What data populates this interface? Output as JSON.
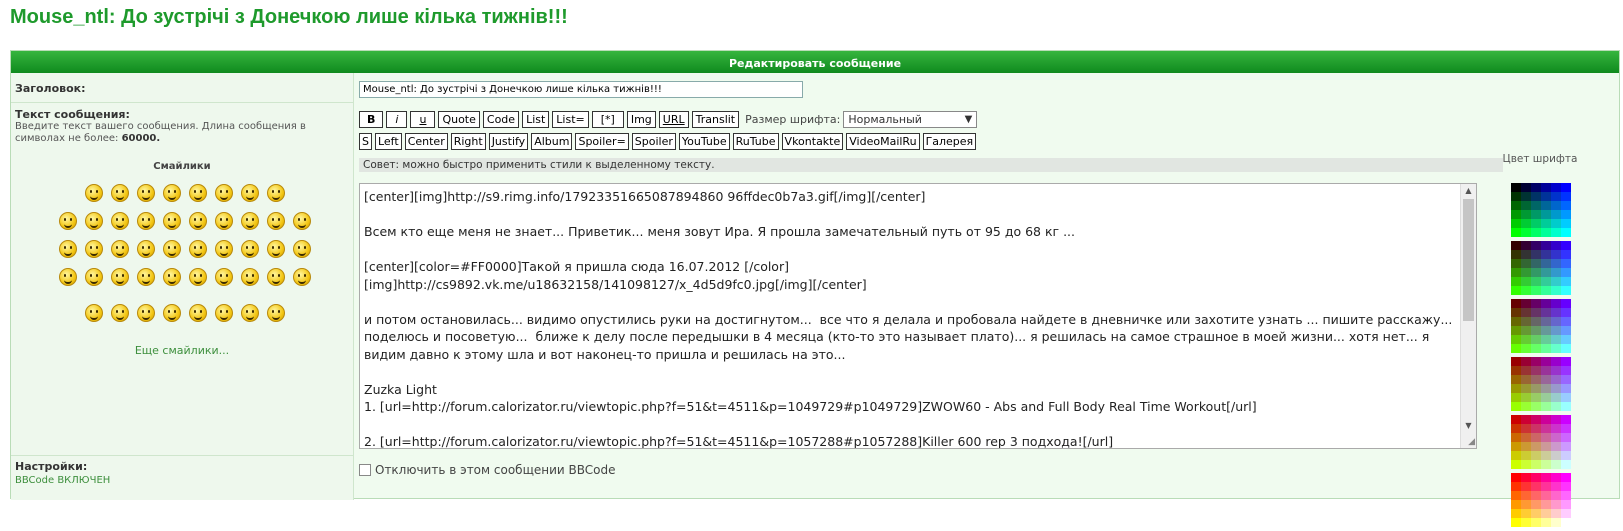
{
  "page_title": "Mouse_ntl: До зустрічі з Донечкою лише кілька тижнів!!!",
  "form_header": "Редактировать сообщение",
  "subject": {
    "label": "Заголовок:",
    "value": "Mouse_ntl: До зустрічі з Донечкою лише кілька тижнів!!!"
  },
  "message": {
    "label": "Текст сообщения:",
    "hint_prefix": "Введите текст вашего сообщения. Длина сообщения в символах не более:",
    "hint_limit": "60000.",
    "smilies_title": "Смайлики",
    "more_smilies": "Еще смайлики...",
    "text": "[center][img]http://s9.rimg.info/17923351665087894860 96ffdec0b7a3.gif[/img][/center]\n\nВсем кто еще меня не знает... Приветик... меня зовут Ира. Я прошла замечательный путь от 95 до 68 кг ...\n\n[center][color=#FF0000]Такой я пришла сюда 16.07.2012 [/color]\n[img]http://cs9892.vk.me/u18632158/141098127/x_4d5d9fc0.jpg[/img][/center]\n\nи потом остановилась... видимо опустились руки на достигнутом...  все что я делала и пробовала найдете в дневничке или захотите узнать ... пишите расскажу... поделюсь и посоветую...  ближе к делу после передышки в 4 месяца (кто-то это называет плато)... я решилась на самое страшное в моей жизни... хотя нет... я видим давно к этому шла и вот наконец-то пришла и решилась на это...\n\nZuzka Light\n1. [url=http://forum.calorizator.ru/viewtopic.php?f=51&t=4511&p=1049729#p1049729]ZWOW60 - Abs and Full Body Real Time Workout[/url]\n\n2. [url=http://forum.calorizator.ru/viewtopic.php?f=51&t=4511&p=1057288#p1057288]Killer 600 rep 3 подхода![/url]"
  },
  "toolbar1": [
    "B",
    "i",
    "u",
    "Quote",
    "Code",
    "List",
    "List=",
    "[*]",
    "Img",
    "URL",
    "Translit"
  ],
  "font_size": {
    "label": "Размер шрифта:",
    "selected": "Нормальный"
  },
  "toolbar2": [
    "S",
    "Left",
    "Center",
    "Right",
    "Justify",
    "Album",
    "Spoiler=",
    "Spoiler",
    "YouTube",
    "RuTube",
    "Vkontakte",
    "VideoMailRu",
    "Галерея"
  ],
  "tip": "Совет: можно быстро применить стили к выделенному тексту.",
  "color_title": "Цвет шрифта",
  "palette": [
    [
      "#000000",
      "#000033",
      "#000066",
      "#000099",
      "#0000cc",
      "#0000ff",
      "#003300",
      "#003333",
      "#003366",
      "#003399",
      "#0033cc",
      "#0033ff",
      "#006600",
      "#006633",
      "#006666",
      "#006699",
      "#0066cc",
      "#0066ff",
      "#009900",
      "#009933",
      "#009966",
      "#009999",
      "#0099cc",
      "#0099ff",
      "#00cc00",
      "#00cc33",
      "#00cc66",
      "#00cc99",
      "#00cccc",
      "#00ccff",
      "#00ff00",
      "#00ff33",
      "#00ff66",
      "#00ff99",
      "#00ffcc",
      "#00ffff"
    ],
    [
      "#330000",
      "#330033",
      "#330066",
      "#330099",
      "#3300cc",
      "#3300ff",
      "#333300",
      "#333333",
      "#333366",
      "#333399",
      "#3333cc",
      "#3333ff",
      "#336600",
      "#336633",
      "#336666",
      "#336699",
      "#3366cc",
      "#3366ff",
      "#339900",
      "#339933",
      "#339966",
      "#339999",
      "#3399cc",
      "#3399ff",
      "#33cc00",
      "#33cc33",
      "#33cc66",
      "#33cc99",
      "#33cccc",
      "#33ccff",
      "#33ff00",
      "#33ff33",
      "#33ff66",
      "#33ff99",
      "#33ffcc",
      "#33ffff"
    ],
    [
      "#660000",
      "#660033",
      "#660066",
      "#660099",
      "#6600cc",
      "#6600ff",
      "#663300",
      "#663333",
      "#663366",
      "#663399",
      "#6633cc",
      "#6633ff",
      "#666600",
      "#666633",
      "#666666",
      "#666699",
      "#6666cc",
      "#6666ff",
      "#669900",
      "#669933",
      "#669966",
      "#669999",
      "#6699cc",
      "#6699ff",
      "#66cc00",
      "#66cc33",
      "#66cc66",
      "#66cc99",
      "#66cccc",
      "#66ccff",
      "#66ff00",
      "#66ff33",
      "#66ff66",
      "#66ff99",
      "#66ffcc",
      "#66ffff"
    ],
    [
      "#990000",
      "#990033",
      "#990066",
      "#990099",
      "#9900cc",
      "#9900ff",
      "#993300",
      "#993333",
      "#993366",
      "#993399",
      "#9933cc",
      "#9933ff",
      "#996600",
      "#996633",
      "#996666",
      "#996699",
      "#9966cc",
      "#9966ff",
      "#999900",
      "#999933",
      "#999966",
      "#999999",
      "#9999cc",
      "#9999ff",
      "#99cc00",
      "#99cc33",
      "#99cc66",
      "#99cc99",
      "#99cccc",
      "#99ccff",
      "#99ff00",
      "#99ff33",
      "#99ff66",
      "#99ff99",
      "#99ffcc",
      "#99ffff"
    ],
    [
      "#cc0000",
      "#cc0033",
      "#cc0066",
      "#cc0099",
      "#cc00cc",
      "#cc00ff",
      "#cc3300",
      "#cc3333",
      "#cc3366",
      "#cc3399",
      "#cc33cc",
      "#cc33ff",
      "#cc6600",
      "#cc6633",
      "#cc6666",
      "#cc6699",
      "#cc66cc",
      "#cc66ff",
      "#cc9900",
      "#cc9933",
      "#cc9966",
      "#cc9999",
      "#cc99cc",
      "#cc99ff",
      "#cccc00",
      "#cccc33",
      "#cccc66",
      "#cccc99",
      "#cccccc",
      "#ccccff",
      "#ccff00",
      "#ccff33",
      "#ccff66",
      "#ccff99",
      "#ccffcc",
      "#ccffff"
    ],
    [
      "#ff0000",
      "#ff0033",
      "#ff0066",
      "#ff0099",
      "#ff00cc",
      "#ff00ff",
      "#ff3300",
      "#ff3333",
      "#ff3366",
      "#ff3399",
      "#ff33cc",
      "#ff33ff",
      "#ff6600",
      "#ff6633",
      "#ff6666",
      "#ff6699",
      "#ff66cc",
      "#ff66ff",
      "#ff9900",
      "#ff9933",
      "#ff9966",
      "#ff9999",
      "#ff99cc",
      "#ff99ff",
      "#ffcc00",
      "#ffcc33",
      "#ffcc66",
      "#ffcc99",
      "#ffcccc",
      "#ffccff",
      "#ffff00",
      "#ffff33",
      "#ffff66",
      "#ffff99",
      "#ffffcc",
      "#ffffff"
    ]
  ],
  "settings": {
    "label": "Настройки:",
    "bbcode_status": "BBCode ВКЛЮЧЕН",
    "disable_bbcode_label": "Отключить в этом сообщении BBCode"
  },
  "smiley_rows": [
    8,
    10,
    10,
    10,
    8
  ]
}
